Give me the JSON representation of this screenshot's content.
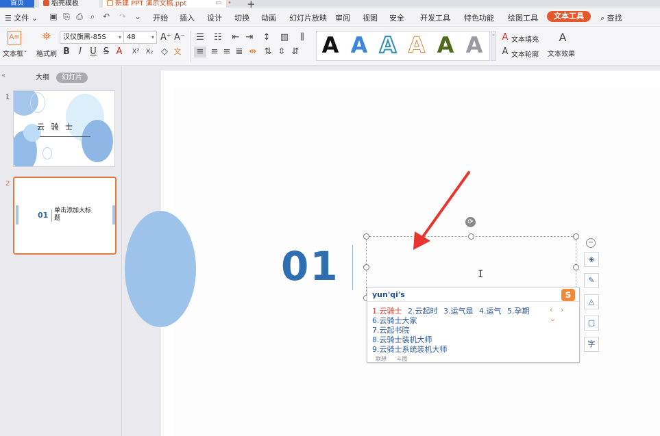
{
  "tabs": {
    "home": "首页",
    "template": "稻壳模板",
    "document": "新建 PPT 演示文稿.ppt"
  },
  "menu": {
    "file": "文件",
    "items": [
      "开始",
      "插入",
      "设计",
      "切换",
      "动画",
      "幻灯片放映",
      "审阅",
      "视图",
      "安全",
      "开发工具",
      "特色功能",
      "绘图工具"
    ],
    "active": "文本工具",
    "search": "查找"
  },
  "ribbon": {
    "textbox_label": "文本框",
    "format_painter_label": "格式刷",
    "font_name": "汉仪旗黑-85S",
    "font_size": "48",
    "style_glyph": "A",
    "text_fill": "文本填充",
    "text_outline": "文本轮廓",
    "text_effect": "文本效果"
  },
  "panel": {
    "outline_tab": "大纲",
    "slides_tab": "幻灯片",
    "slide1_num": "1",
    "slide1_title": "云  骑  士",
    "slide2_num": "2",
    "slide2_number": "01",
    "slide2_title": "单击添加大标题"
  },
  "slide": {
    "number": "01"
  },
  "ime": {
    "input": "yun'qi's",
    "logo": "S",
    "first_row": [
      "1.云骑士",
      "2.云起时",
      "3.运气是",
      "4.运气",
      "5.孕期"
    ],
    "candidates": [
      "6.云骑士大家",
      "7.云起书院",
      "8.云骑士装机大师",
      "9.云骑士系统装机大师"
    ],
    "nav": "‹ › ⌄",
    "footer": [
      "联想",
      "斗图"
    ]
  },
  "colors": {
    "accent": "#e3572d",
    "tab_home": "#2b6cd4",
    "number_blue": "#2f6fb1",
    "arrow_red": "#e8342e"
  }
}
